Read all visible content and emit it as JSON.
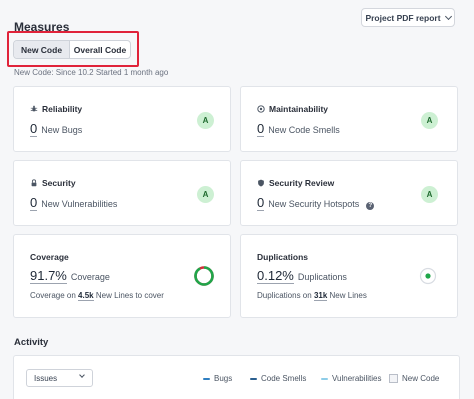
{
  "header": {
    "title": "Measures",
    "pdf_button_label": "Project PDF report"
  },
  "toggle": {
    "new_code_label": "New Code",
    "overall_code_label": "Overall Code"
  },
  "subtitle": "New Code: Since 10.2  Started 1 month ago",
  "cards": {
    "reliability": {
      "title": "Reliability",
      "value": "0",
      "label": "New Bugs",
      "grade": "A",
      "icon": "bug-icon"
    },
    "maintainability": {
      "title": "Maintainability",
      "value": "0",
      "label": "New Code Smells",
      "grade": "A",
      "icon": "smell-icon"
    },
    "security": {
      "title": "Security",
      "value": "0",
      "label": "New Vulnerabilities",
      "grade": "A",
      "icon": "lock-icon"
    },
    "security_review": {
      "title": "Security Review",
      "value": "0",
      "label": "New Security Hotspots",
      "grade": "A",
      "icon": "shield-icon",
      "help": "?"
    },
    "coverage": {
      "title": "Coverage",
      "value": "91.7%",
      "label": "Coverage",
      "on_prefix": "Coverage on",
      "lines": "4.5k",
      "lines_suffix": "New Lines to cover",
      "percent": 91.7
    },
    "duplications": {
      "title": "Duplications",
      "value": "0.12%",
      "label": "Duplications",
      "on_prefix": "Duplications on",
      "lines": "31k",
      "lines_suffix": "New Lines"
    }
  },
  "activity": {
    "title": "Activity",
    "select_value": "Issues",
    "legend": [
      {
        "label": "Bugs",
        "color": "#2f7fc1"
      },
      {
        "label": "Code Smells",
        "color": "#2b5f8f"
      },
      {
        "label": "Vulnerabilities",
        "color": "#8ecde8"
      },
      {
        "label": "New Code",
        "color": "#e8eaef"
      }
    ]
  },
  "colors": {
    "highlight": "#e0233a",
    "grade_bg": "#cdf0d3",
    "coverage_green": "#1fa64a",
    "coverage_red": "#d02f3a"
  }
}
